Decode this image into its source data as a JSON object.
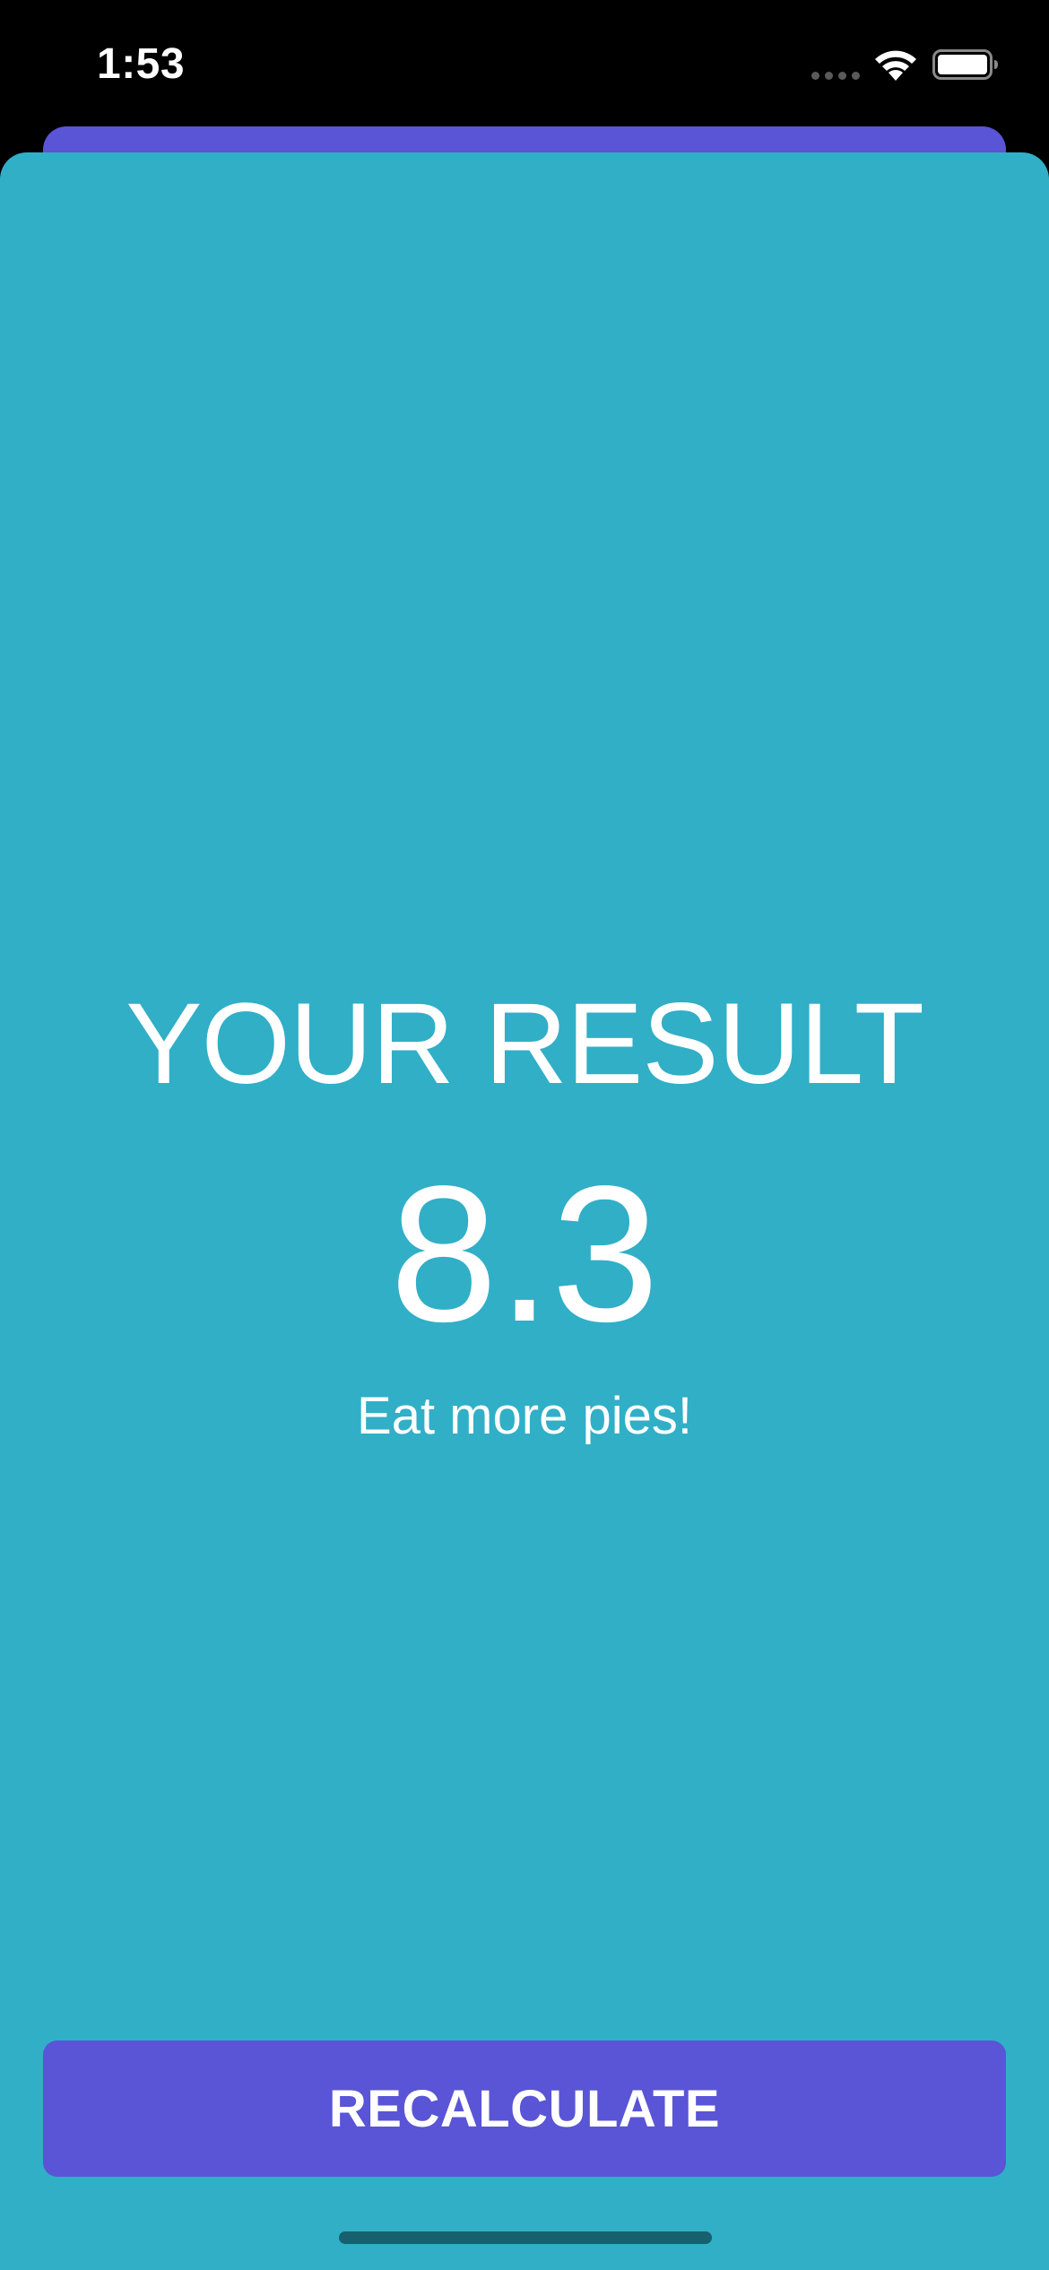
{
  "status_bar": {
    "time": "1:53"
  },
  "result": {
    "title": "YOUR RESULT",
    "value": "8.3",
    "advice": "Eat more pies!"
  },
  "actions": {
    "recalculate_label": "RECALCULATE"
  },
  "colors": {
    "sheet_background": "#30afc7",
    "button_background": "#5a54d6",
    "text": "#ffffff",
    "status_bar_background": "#000000"
  },
  "icons": {
    "signal": "cellular-signal-icon",
    "wifi": "wifi-icon",
    "battery": "battery-icon"
  }
}
